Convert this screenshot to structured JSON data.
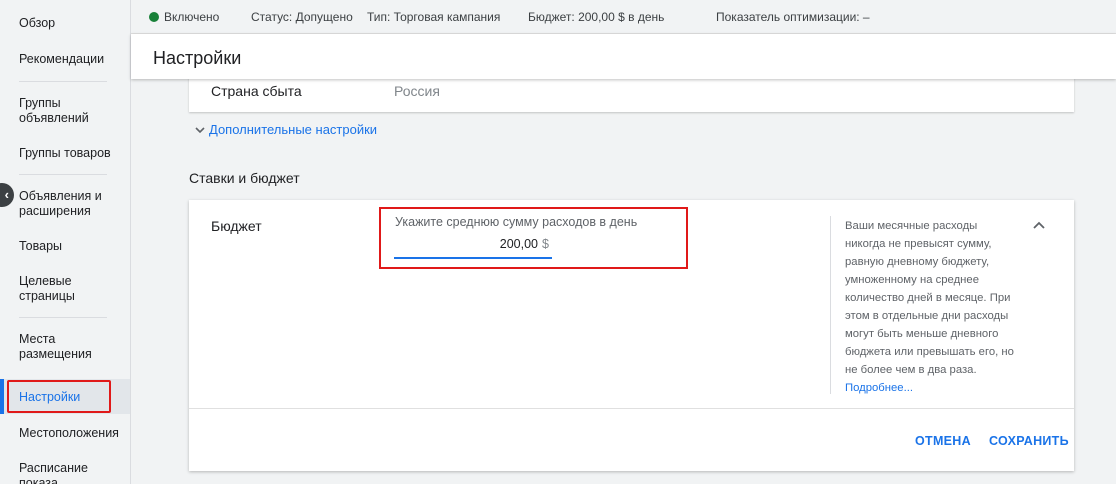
{
  "sidebar": {
    "items": [
      {
        "label": "Обзор"
      },
      {
        "label": "Рекомендации"
      },
      {
        "label": "Группы объявлений"
      },
      {
        "label": "Группы товаров"
      },
      {
        "label": "Объявления и расширения"
      },
      {
        "label": "Товары"
      },
      {
        "label": "Целевые страницы"
      },
      {
        "label": "Места размещения"
      },
      {
        "label": "Настройки"
      },
      {
        "label": "Местоположения"
      },
      {
        "label": "Расписание показа"
      }
    ],
    "active_index": 8,
    "collapse_glyph": "‹"
  },
  "status": {
    "state": "Включено",
    "status_text": "Статус: Допущено",
    "type_text": "Тип: Торговая кампания",
    "budget_text": "Бюджет: 200,00 $ в день",
    "optimization_text": "Показатель оптимизации: –",
    "state_color": "#188038"
  },
  "page": {
    "title": "Настройки"
  },
  "top_card": {
    "label": "Страна сбыта",
    "value": "Россия"
  },
  "advanced_link": "Дополнительные настройки",
  "section_title": "Ставки и бюджет",
  "budget": {
    "label": "Бюджет",
    "input_label": "Укажите среднюю сумму расходов в день",
    "input_value": "200,00",
    "currency": "$",
    "help_text": "Ваши месячные расходы никогда не превысят сумму, равную дневному бюджету, умноженному на среднее количество дней в месяце. При этом в отдельные дни расходы могут быть меньше дневного бюджета или превышать его, но не более чем в два раза.",
    "help_more": "Подробнее...",
    "cancel_label": "ОТМЕНА",
    "save_label": "СОХРАНИТЬ"
  },
  "colors": {
    "accent": "#1a73e8",
    "highlight": "#e01919"
  },
  "icons": {
    "chevron_down": "chevron-down-icon",
    "chevron_up": "chevron-up-icon",
    "collapse": "chevron-left-icon"
  }
}
